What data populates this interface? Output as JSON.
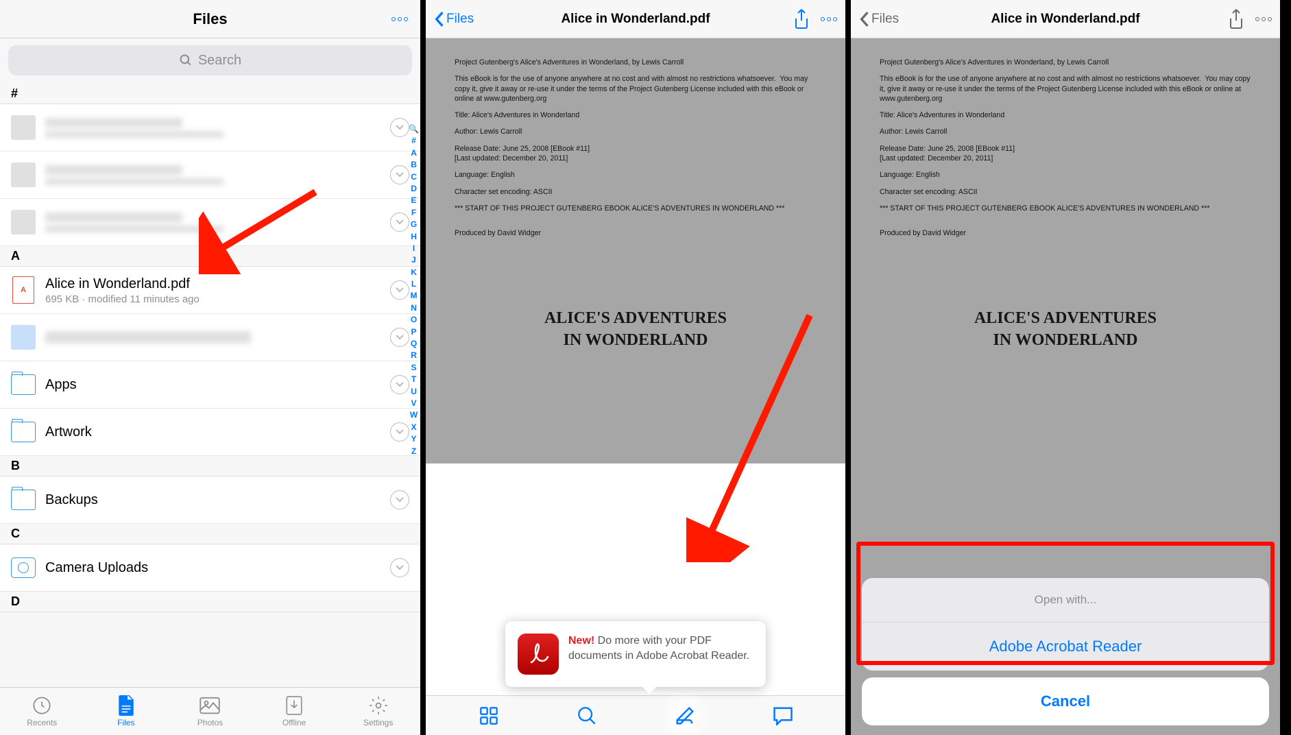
{
  "colors": {
    "accent": "#007aff",
    "danger": "#ff3b30"
  },
  "panel1": {
    "title": "Files",
    "search_placeholder": "Search",
    "sections": {
      "hash": "#",
      "a": "A",
      "b": "B",
      "c": "C",
      "d": "D"
    },
    "items": {
      "alice": {
        "name": "Alice in Wonderland.pdf",
        "meta": "695 KB · modified 11 minutes ago"
      },
      "apps": {
        "name": "Apps"
      },
      "artwork": {
        "name": "Artwork"
      },
      "backups": {
        "name": "Backups"
      },
      "camera": {
        "name": "Camera Uploads"
      }
    },
    "index": [
      "🔍",
      "#",
      "A",
      "B",
      "C",
      "D",
      "E",
      "F",
      "G",
      "H",
      "I",
      "J",
      "K",
      "L",
      "M",
      "N",
      "O",
      "P",
      "Q",
      "R",
      "S",
      "T",
      "U",
      "V",
      "W",
      "X",
      "Y",
      "Z"
    ],
    "tabs": {
      "recents": "Recents",
      "files": "Files",
      "photos": "Photos",
      "offline": "Offline",
      "settings": "Settings"
    }
  },
  "viewer": {
    "back": "Files",
    "title": "Alice in Wonderland.pdf",
    "pdf": {
      "p1": "Project Gutenberg's Alice's Adventures in Wonderland, by Lewis Carroll",
      "p2": "This eBook is for the use of anyone anywhere at no cost and with almost no restrictions whatsoever.  You may copy it, give it away or re-use it under the terms of the Project Gutenberg License included with this eBook or online at www.gutenberg.org",
      "p3": "Title: Alice's Adventures in Wonderland",
      "p4": "Author: Lewis Carroll",
      "p5": "Release Date: June 25, 2008 [EBook #11]\n[Last updated: December 20, 2011]",
      "p6": "Language: English",
      "p7": "Character set encoding: ASCII",
      "p8": "*** START OF THIS PROJECT GUTENBERG EBOOK ALICE'S ADVENTURES IN WONDERLAND ***",
      "p9": "Produced by David Widger",
      "title1": "ALICE'S ADVENTURES",
      "title2": "IN WONDERLAND"
    },
    "tooltip": {
      "new": "New!",
      "text": " Do more with your PDF documents in Adobe Acrobat Reader."
    }
  },
  "sheet": {
    "header": "Open with...",
    "option1": "Adobe Acrobat Reader",
    "cancel": "Cancel"
  }
}
